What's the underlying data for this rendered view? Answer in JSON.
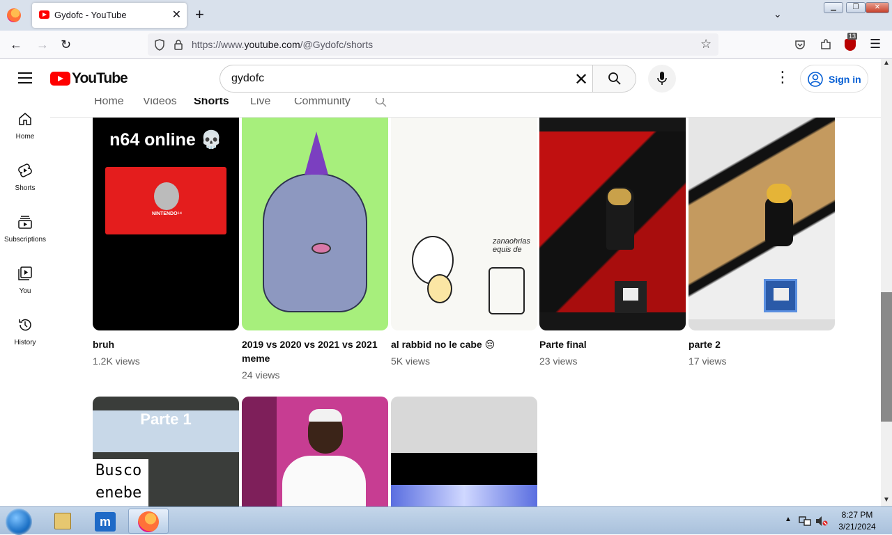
{
  "browser": {
    "tab_title": "Gydofc - YouTube",
    "url_prefix": "https://www.",
    "url_domain": "youtube.com",
    "url_path": "/@Gydofc/shorts",
    "extension_badge": "13"
  },
  "youtube": {
    "logo_text": "YouTube",
    "search_value": "gydofc",
    "signin_label": "Sign in"
  },
  "sidebar": {
    "items": [
      {
        "label": "Home",
        "icon": "home-icon"
      },
      {
        "label": "Shorts",
        "icon": "shorts-icon"
      },
      {
        "label": "Subscriptions",
        "icon": "subscriptions-icon"
      },
      {
        "label": "You",
        "icon": "you-icon"
      },
      {
        "label": "History",
        "icon": "history-icon"
      }
    ]
  },
  "channel_tabs": [
    "Home",
    "Videos",
    "Shorts",
    "Live",
    "Community"
  ],
  "active_tab": "Shorts",
  "shorts": [
    {
      "title": "bruh",
      "views": "1.2K views",
      "thumb_text": "n64 online 💀"
    },
    {
      "title": "2019 vs 2020 vs 2021 vs 2021 meme",
      "views": "24 views"
    },
    {
      "title": "al rabbid no le cabe 😔",
      "views": "5K views",
      "thumb_text": "zanaohrias equis de"
    },
    {
      "title": "Parte final",
      "views": "23 views"
    },
    {
      "title": "parte 2",
      "views": "17 views"
    }
  ],
  "shorts_row2": [
    {
      "thumb_text_1": "Parte 1",
      "thumb_text_2": "Busco",
      "thumb_text_3": "enebe"
    },
    {},
    {}
  ],
  "taskbar": {
    "time": "8:27 PM",
    "date": "3/21/2024"
  }
}
